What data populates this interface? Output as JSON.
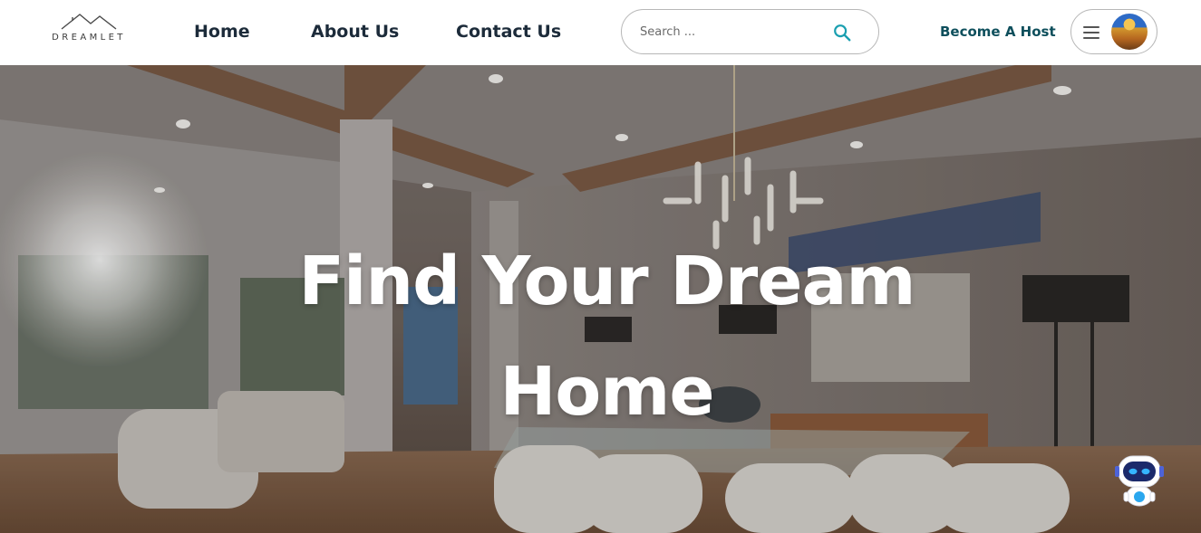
{
  "brand": {
    "name": "DREAMLET",
    "logo_icon": "house-roof-icon"
  },
  "nav": {
    "links": [
      {
        "label": "Home"
      },
      {
        "label": "About Us"
      },
      {
        "label": "Contact Us"
      }
    ],
    "search": {
      "placeholder": "Search ...",
      "icon": "search-icon",
      "icon_color": "#1a9fb0"
    },
    "become_host": "Become A Host",
    "user_menu": {
      "icon": "hamburger-icon",
      "avatar": "avatar"
    }
  },
  "hero": {
    "title": "Find Your Dream Home",
    "background": "interior-dining-room-photo"
  },
  "chatbot": {
    "icon": "robot-assistant-icon"
  },
  "colors": {
    "nav_text": "#1c2b3a",
    "host_text": "#0e4f5c",
    "search_icon": "#1a9fb0"
  }
}
